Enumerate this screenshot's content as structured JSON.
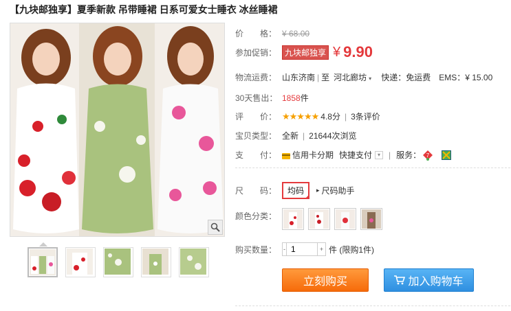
{
  "title": "【九块邮独享】夏季新款 吊带睡裙 日系可爱女士睡衣 冰丝睡裙",
  "price": {
    "label": "价　　格：",
    "value": "¥ 68.00"
  },
  "promo": {
    "label": "参加促销：",
    "tag": "九块邮独享",
    "yen": "¥",
    "price": "9.90"
  },
  "shipping": {
    "label": "物流运费：",
    "from": "山东济南",
    "sep": "|",
    "to_prefix": "至",
    "to": "河北廊坊",
    "express": "快递：免运费",
    "ems": "EMS：¥ 15.00"
  },
  "sold": {
    "label": "30天售出：",
    "count": "1858",
    "unit": "件"
  },
  "rating": {
    "label": "评　　价：",
    "stars": "★★★★★",
    "score": "4.8分",
    "sep": "|",
    "reviews": "3条评价"
  },
  "type": {
    "label": "宝贝类型：",
    "value": "全新",
    "sep": "|",
    "views": "21644次浏览"
  },
  "payment": {
    "label": "支　　付：",
    "card": "信用卡分期",
    "quick": "快捷支付",
    "service_label": "服务："
  },
  "size": {
    "label": "尺　　码：",
    "selected": "均码",
    "helper": "尺码助手"
  },
  "color": {
    "label": "颜色分类："
  },
  "quantity": {
    "label": "购买数量：",
    "value": "1",
    "unit": "件 (限购1件)",
    "minus": "-",
    "plus": "+"
  },
  "buttons": {
    "buy": "立刻购买",
    "cart": "加入购物车"
  },
  "icons": {
    "zoom": "magnifier-icon",
    "card": "credit-card-icon",
    "dropdown": "dropdown-icon",
    "service1": "seven-day-return-icon",
    "service2": "guarantee-icon",
    "cart": "cart-icon"
  },
  "colors": {
    "accent_red": "#e4393c",
    "buy_orange": "#f66b0a",
    "cart_blue": "#2f8fe0",
    "star": "#f6a000"
  }
}
